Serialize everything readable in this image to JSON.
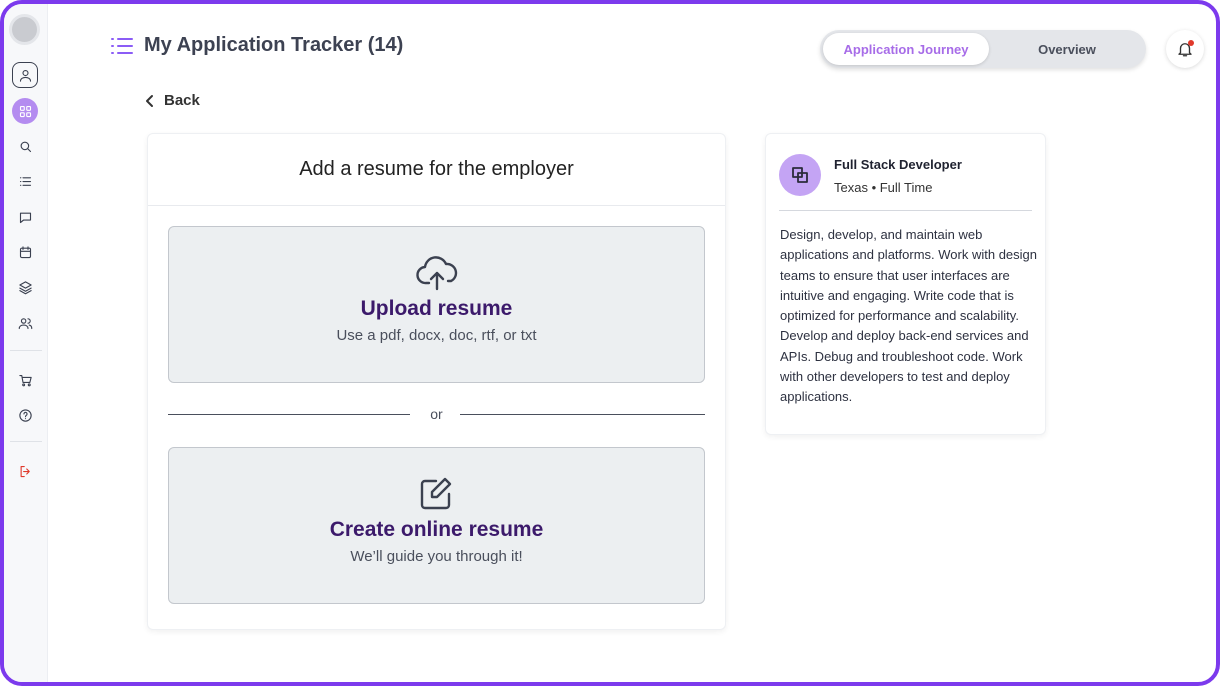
{
  "header": {
    "title": "My Application Tracker (14)",
    "tabs": [
      {
        "label": "Application Journey",
        "active": true
      },
      {
        "label": "Overview",
        "active": false
      }
    ]
  },
  "sidebar": {
    "items": [
      {
        "name": "profile",
        "icon": "user-icon"
      },
      {
        "name": "dashboard",
        "icon": "grid-icon",
        "active": true
      },
      {
        "name": "search",
        "icon": "search-icon"
      },
      {
        "name": "list",
        "icon": "list-icon"
      },
      {
        "name": "messages",
        "icon": "chat-icon"
      },
      {
        "name": "calendar",
        "icon": "calendar-icon"
      },
      {
        "name": "layers",
        "icon": "layers-icon"
      },
      {
        "name": "people",
        "icon": "users-icon"
      },
      {
        "name": "cart",
        "icon": "cart-icon"
      },
      {
        "name": "help",
        "icon": "help-icon"
      },
      {
        "name": "logout",
        "icon": "logout-icon"
      }
    ]
  },
  "back_label": "Back",
  "resume_card": {
    "title": "Add a resume for the employer",
    "upload": {
      "title": "Upload resume",
      "subtitle": "Use a pdf, docx, doc, rtf, or txt"
    },
    "or_label": "or",
    "create": {
      "title": "Create online resume",
      "subtitle": "We’ll guide you through it!"
    }
  },
  "job": {
    "title": "Full Stack Developer",
    "meta": "Texas • Full Time",
    "description": "Design, develop, and maintain web applications and platforms. Work with design teams to ensure that user interfaces are intuitive and engaging. Write code that is optimized for performance and scalability. Develop and deploy back-end services and APIs. Debug and troubleshoot code. Work with other developers to test and deploy applications."
  },
  "colors": {
    "accent": "#7c3aed",
    "active_tab_text": "#a76ce8",
    "option_title": "#3c1a6b",
    "logout": "#e0392b"
  }
}
